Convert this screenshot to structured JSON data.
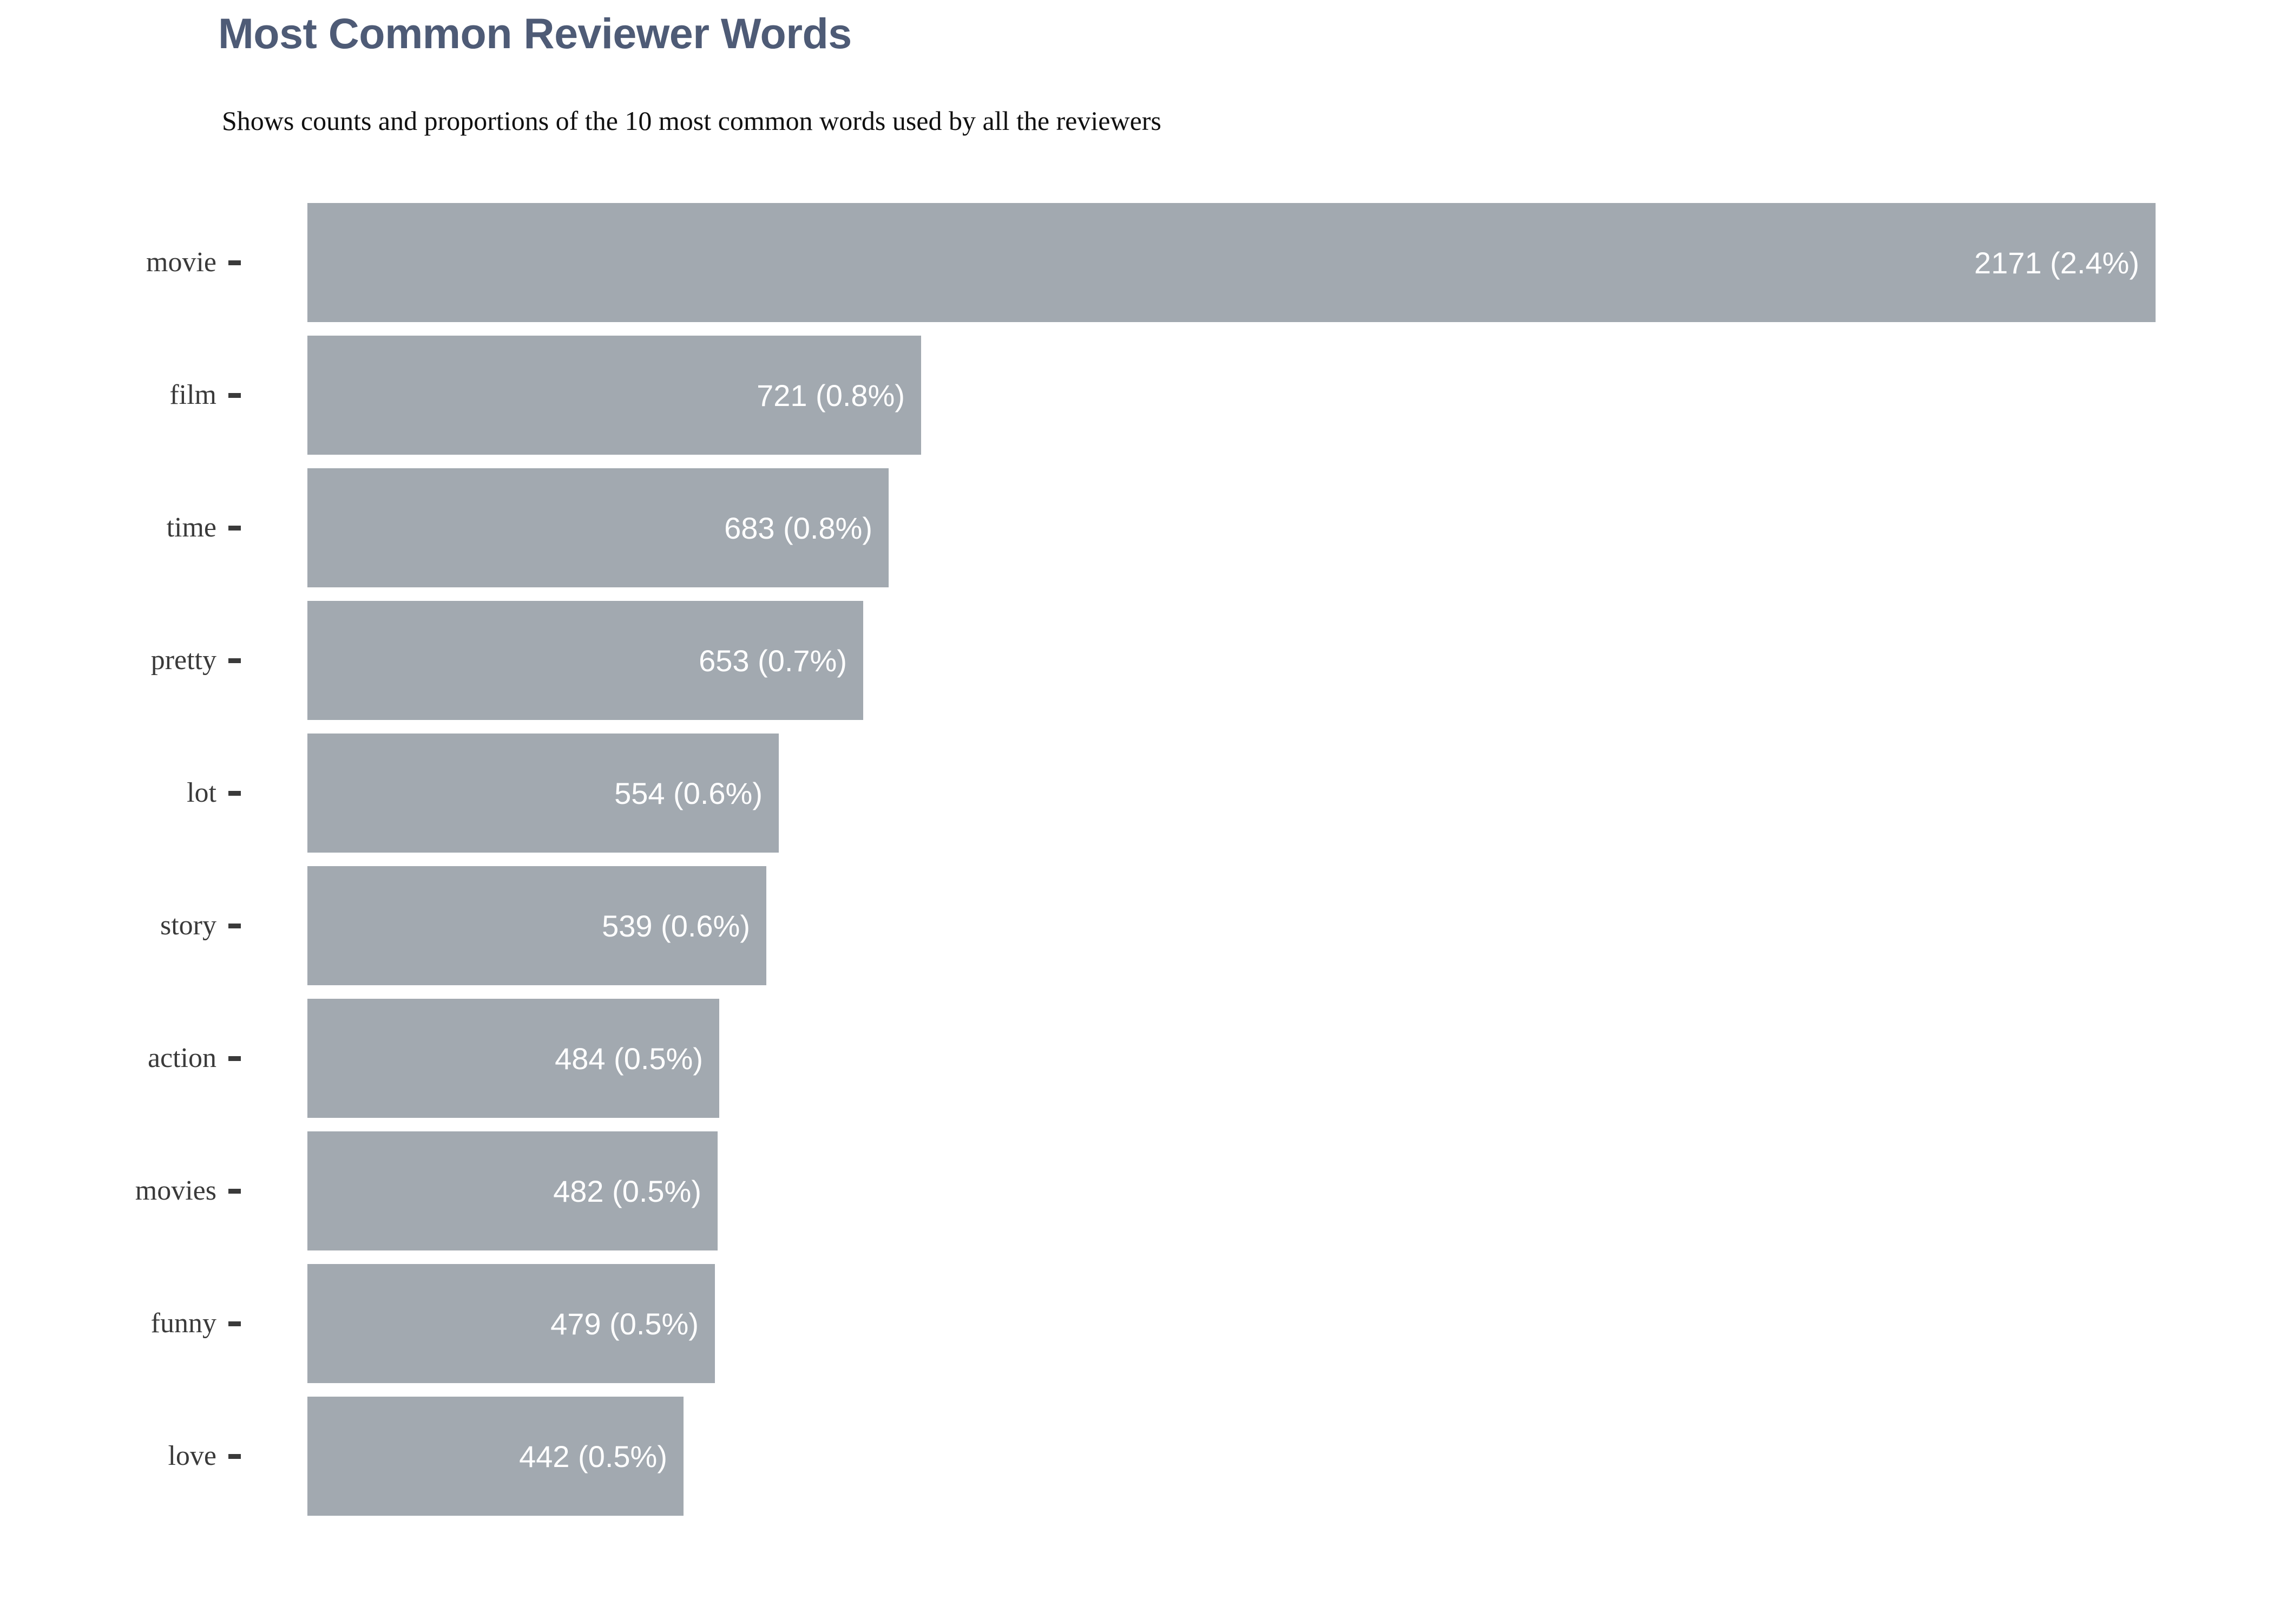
{
  "header": {
    "title": "Most Common Reviewer Words",
    "subtitle": "Shows counts and proportions of the 10 most common words used by all the reviewers"
  },
  "colors": {
    "bar": "#a2a9b0",
    "title": "#4e5b76",
    "subtitle": "#101010",
    "axis_label": "#3a3a3a",
    "value_label": "#ffffff",
    "background": "#ffffff"
  },
  "chart_data": {
    "type": "bar",
    "orientation": "horizontal",
    "title": "Most Common Reviewer Words",
    "subtitle": "Shows counts and proportions of the 10 most common words used by all the reviewers",
    "xlabel": "",
    "ylabel": "",
    "grid": false,
    "legend": "none",
    "xlim": [
      0,
      2171
    ],
    "categories": [
      "movie",
      "film",
      "time",
      "pretty",
      "lot",
      "story",
      "action",
      "movies",
      "funny",
      "love"
    ],
    "values": [
      2171,
      721,
      683,
      653,
      554,
      539,
      484,
      482,
      479,
      442
    ],
    "percentages": [
      2.4,
      0.8,
      0.8,
      0.7,
      0.6,
      0.6,
      0.5,
      0.5,
      0.5,
      0.5
    ],
    "data_labels": [
      "2171 (2.4%)",
      "721 (0.8%)",
      "683 (0.8%)",
      "653 (0.7%)",
      "554 (0.6%)",
      "539 (0.6%)",
      "484 (0.5%)",
      "482 (0.5%)",
      "479 (0.5%)",
      "442 (0.5%)"
    ]
  }
}
